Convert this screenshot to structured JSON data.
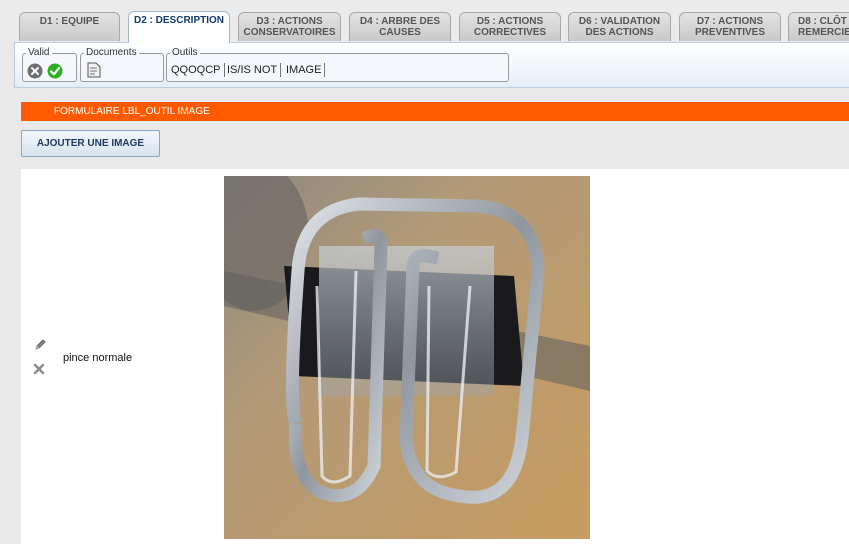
{
  "tabs": [
    {
      "label_l1": "D1 : EQUIPE",
      "label_l2": ""
    },
    {
      "label_l1": "D2 : DESCRIPTION",
      "label_l2": ""
    },
    {
      "label_l1": "D3 : ACTIONS",
      "label_l2": "CONSERVATOIRES"
    },
    {
      "label_l1": "D4 : ARBRE DES",
      "label_l2": "CAUSES"
    },
    {
      "label_l1": "D5 : ACTIONS",
      "label_l2": "CORRECTIVES"
    },
    {
      "label_l1": "D6 : VALIDATION",
      "label_l2": "DES ACTIONS"
    },
    {
      "label_l1": "D7 : ACTIONS",
      "label_l2": "PREVENTIVES"
    },
    {
      "label_l1": "D8 : CLÔT",
      "label_l2": "REMERCIE"
    }
  ],
  "active_tab": "D2 : DESCRIPTION",
  "toolbar": {
    "valid_legend": "Valid",
    "documents_legend": "Documents",
    "outils_legend": "Outils",
    "tools": [
      "QQOQCP",
      "IS/IS NOT",
      "IMAGE"
    ]
  },
  "form": {
    "header": "FORMULAIRE LBL_OUTIL IMAGE",
    "add_button": "AJOUTER UNE IMAGE"
  },
  "image_entry": {
    "caption": "pince normale"
  },
  "colors": {
    "accent": "#ff5a00",
    "active_tab_text": "#123a6b",
    "valid_ok": "#2bb01f",
    "valid_cancel": "#6e6e6e"
  }
}
